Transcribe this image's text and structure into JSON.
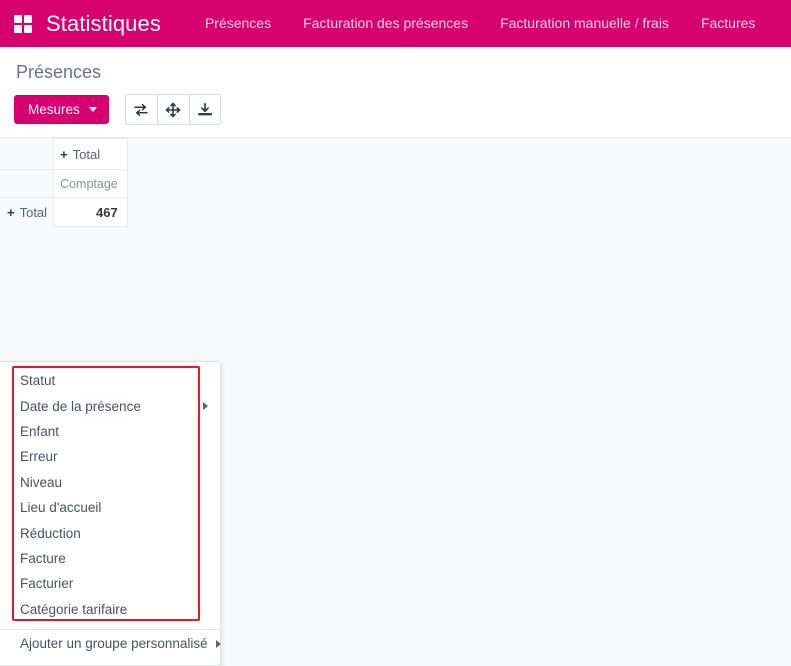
{
  "navbar": {
    "apps_icon": "apps-grid-icon",
    "brand": "Statistiques",
    "links": [
      {
        "label": "Présences"
      },
      {
        "label": "Facturation des présences"
      },
      {
        "label": "Facturation manuelle / frais"
      },
      {
        "label": "Factures"
      }
    ],
    "background_color": "#d6006e"
  },
  "control_panel": {
    "page_title": "Présences",
    "measures_button": {
      "label": "Mesures",
      "icon": "chevron-down-icon",
      "background_color": "#d6006e"
    },
    "tool_buttons": [
      {
        "name": "flip-axis-button",
        "icon": "flip-axis-icon",
        "tooltip": "Inverser l'axe"
      },
      {
        "name": "expand-all-button",
        "icon": "expand-arrows-icon",
        "tooltip": "Tout déplier"
      },
      {
        "name": "download-button",
        "icon": "download-icon",
        "tooltip": "Télécharger xlsx"
      }
    ]
  },
  "pivot_table": {
    "corner_label": "",
    "column_header": {
      "expander": "+",
      "label": "Total"
    },
    "measure_header": "Comptage",
    "rows": [
      {
        "expander": "+",
        "label": "Total",
        "values": [
          "467"
        ]
      }
    ]
  },
  "dropdown": {
    "groupby_items": [
      {
        "label": "Statut",
        "has_submenu": false
      },
      {
        "label": "Date de la présence",
        "has_submenu": true
      },
      {
        "label": "Enfant",
        "has_submenu": false
      },
      {
        "label": "Erreur",
        "has_submenu": false
      },
      {
        "label": "Niveau",
        "has_submenu": false
      },
      {
        "label": "Lieu d'accueil",
        "has_submenu": false
      },
      {
        "label": "Réduction",
        "has_submenu": false
      },
      {
        "label": "Facture",
        "has_submenu": false
      },
      {
        "label": "Facturier",
        "has_submenu": false
      },
      {
        "label": "Catégorie tarifaire",
        "has_submenu": false
      }
    ],
    "footer_item": {
      "label": "Ajouter un groupe personnalisé",
      "has_submenu": true
    }
  },
  "annotation": {
    "highlight_color": "#e01b24"
  }
}
